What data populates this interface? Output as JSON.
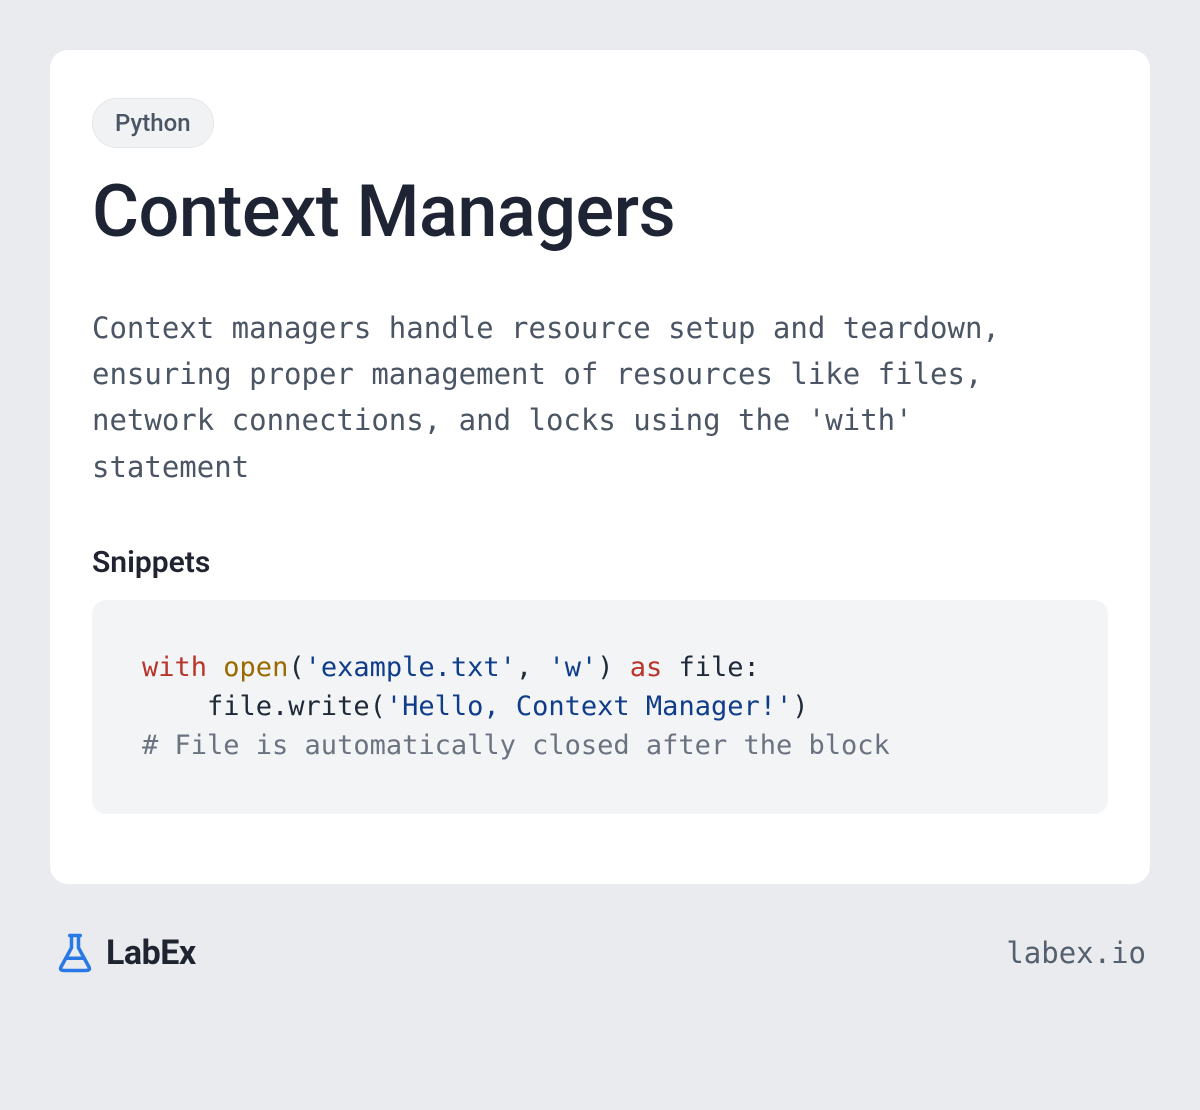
{
  "tag": "Python",
  "title": "Context Managers",
  "description": "Context managers handle resource setup and teardown, ensuring proper management of resources like files, network connections, and locks using the 'with' statement",
  "snippets_label": "Snippets",
  "code": {
    "tokens": [
      {
        "t": "with",
        "c": "kw"
      },
      {
        "t": " ",
        "c": "plain"
      },
      {
        "t": "open",
        "c": "fn"
      },
      {
        "t": "(",
        "c": "plain"
      },
      {
        "t": "'example.txt'",
        "c": "str"
      },
      {
        "t": ", ",
        "c": "plain"
      },
      {
        "t": "'w'",
        "c": "str"
      },
      {
        "t": ") ",
        "c": "plain"
      },
      {
        "t": "as",
        "c": "kw"
      },
      {
        "t": " file:\n    file.write(",
        "c": "plain"
      },
      {
        "t": "'Hello, Context Manager!'",
        "c": "str"
      },
      {
        "t": ")\n",
        "c": "plain"
      },
      {
        "t": "# File is automatically closed after the block",
        "c": "comment"
      }
    ]
  },
  "brand": "LabEx",
  "site": "labex.io"
}
